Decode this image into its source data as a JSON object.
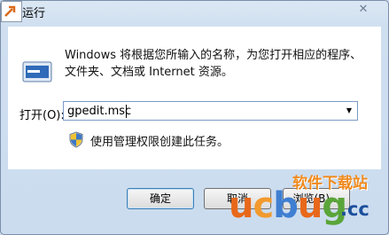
{
  "window": {
    "title": "运行",
    "icon": "run-icon",
    "close_label": "✕"
  },
  "dialog": {
    "description": "Windows 将根据您所输入的名称，为您打开相应的程序、文件夹、文档或 Internet 资源。",
    "open_label": "打开(O):",
    "command_value": "gpedit.msc",
    "admin_note": "使用管理权限创建此任务。",
    "dropdown_icon": "chevron-down-icon",
    "shield_icon": "uac-shield-icon"
  },
  "buttons": {
    "ok": "确定",
    "cancel": "取消",
    "browse": "浏览(B)..."
  },
  "watermark": {
    "chinese_text": "软件下载站",
    "logo_u": "u",
    "logo_c": "c",
    "logo_b": "b",
    "logo_u2": "u",
    "logo_g": "g",
    "logo_cc": ".cc"
  }
}
